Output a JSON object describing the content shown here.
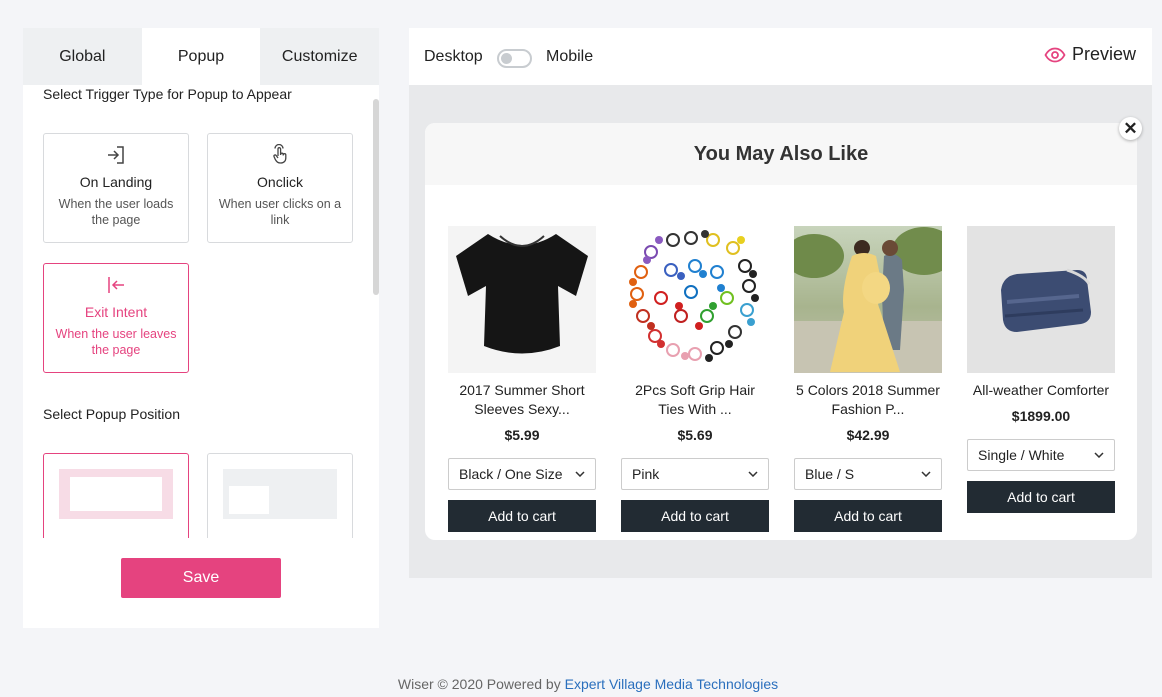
{
  "tabs": [
    "Global",
    "Popup",
    "Customize"
  ],
  "active_tab": "Popup",
  "trigger": {
    "heading": "Select Trigger Type for Popup to Appear",
    "options": [
      {
        "icon": "enter-icon",
        "title": "On Landing",
        "desc": "When the user loads the page"
      },
      {
        "icon": "tap-icon",
        "title": "Onclick",
        "desc": "When user clicks on a link"
      },
      {
        "icon": "exit-icon",
        "title": "Exit Intent",
        "desc": "When the user leaves the page"
      }
    ],
    "selected": "Exit Intent"
  },
  "position": {
    "heading": "Select Popup Position",
    "options": [
      "center",
      "left"
    ],
    "selected": "center"
  },
  "save_label": "Save",
  "preview_header": {
    "desktop_label": "Desktop",
    "mobile_label": "Mobile",
    "preview_label": "Preview",
    "toggle_mobile": false
  },
  "popup": {
    "title": "You May Also Like",
    "close_icon": "close-icon",
    "products": [
      {
        "name": "2017 Summer Short Sleeves Sexy...",
        "price": "$5.99",
        "variant": "Black / One Size",
        "button": "Add to cart",
        "image": "black-crop-top"
      },
      {
        "name": "2Pcs Soft Grip Hair Ties With ...",
        "price": "$5.69",
        "variant": "Pink",
        "button": "Add to cart",
        "image": "hair-ties"
      },
      {
        "name": "5 Colors 2018 Summer Fashion P...",
        "price": "$42.99",
        "variant": "Blue / S",
        "button": "Add to cart",
        "image": "maternity-photo"
      },
      {
        "name": "All-weather Comforter",
        "price": "$1899.00",
        "variant": "Single / White",
        "button": "Add to cart",
        "image": "folded-comforter"
      }
    ]
  },
  "footer": {
    "prefix": "Wiser © 2020 Powered by ",
    "link_text": "Expert Village Media Technologies"
  },
  "colors": {
    "accent": "#e5437f",
    "button_dark": "#222b33",
    "link": "#2a6fbd"
  }
}
